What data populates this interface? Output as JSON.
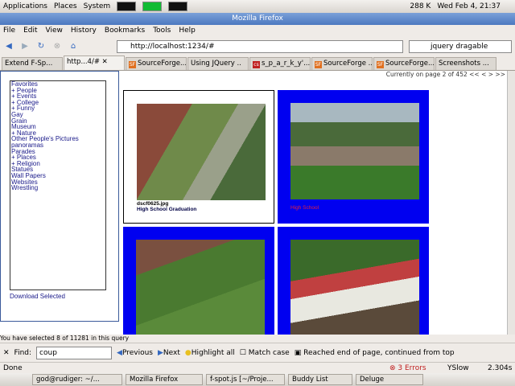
{
  "panel": {
    "applications": "Applications",
    "places": "Places",
    "system": "System",
    "net_speed": "288 K",
    "clock": "Wed Feb  4, 21:37"
  },
  "window": {
    "title": "Mozilla Firefox"
  },
  "menu": [
    "File",
    "Edit",
    "View",
    "History",
    "Bookmarks",
    "Tools",
    "Help"
  ],
  "nav": {
    "url": "http://localhost:1234/#",
    "search": "jquery dragable"
  },
  "tabs": [
    {
      "label": "Extend F-Sp...",
      "icon": "page"
    },
    {
      "label": "http...4/#",
      "icon": "page",
      "active": true
    },
    {
      "label": "SourceForge...",
      "icon": "sf"
    },
    {
      "label": "Using JQuery ..",
      "icon": "page"
    },
    {
      "label": "s_p_a_r_k_y'...",
      "icon": "cs"
    },
    {
      "label": "SourceForge ..",
      "icon": "sf"
    },
    {
      "label": "SourceForge...",
      "icon": "sf"
    },
    {
      "label": "Screenshots ...",
      "icon": "flower"
    }
  ],
  "pager": "Currently on page 2 of 452 << < > >>",
  "categories": [
    "Favorites",
    "+ People",
    "+ Events",
    "+ College",
    "+ Funny",
    "Gay",
    "Grain",
    "Museum",
    "+ Nature",
    "Other People's Pictures",
    "panoramas",
    "Parades",
    "+ Places",
    "+ Religion",
    "Statues",
    "Wall Papers",
    "Websites",
    "Wrestling"
  ],
  "download_label": "Download Selected",
  "photos": [
    {
      "filename": "dscf0625.jpg",
      "caption": "High School Graduation",
      "selected": false
    },
    {
      "caption": "High School",
      "selected": true
    },
    {
      "selected": true
    },
    {
      "selected": true
    }
  ],
  "selection_msg": "You have selected 8 of 11281 in this query",
  "find": {
    "label": "Find:",
    "value": "coup",
    "previous": "Previous",
    "next": "Next",
    "highlight": "Highlight all",
    "match_case": "Match case",
    "message": "Reached end of page, continued from top"
  },
  "status": {
    "text": "Done",
    "errors": "3 Errors",
    "yslow": "YSlow",
    "time": "2.304s"
  },
  "taskbar": [
    "god@rudiger: ~/...",
    "Mozilla Firefox",
    "f-spot.js [~/Proje...",
    "Buddy List",
    "Deluge"
  ]
}
